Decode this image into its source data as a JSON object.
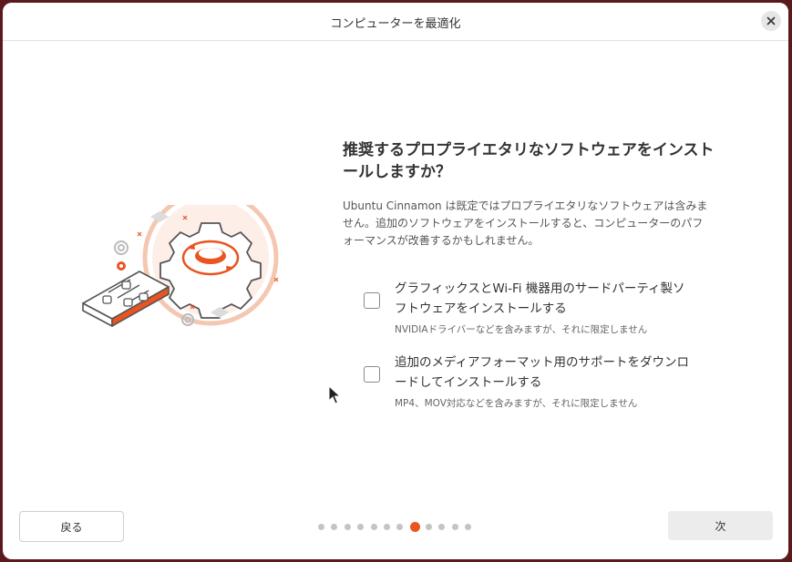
{
  "window": {
    "title": "コンピューターを最適化"
  },
  "content": {
    "heading": "推奨するプロプライエタリなソフトウェアをインストールしますか？",
    "description": "Ubuntu Cinnamon は既定ではプロプライエタリなソフトウェアは含みません。追加のソフトウェアをインストールすると、コンピューターのパフォーマンスが改善するかもしれません。",
    "options": [
      {
        "label": "グラフィックスとWi-Fi 機器用のサードパーティ製ソフトウェアをインストールする",
        "sublabel": "NVIDIAドライバーなどを含みますが、それに限定しません",
        "checked": false
      },
      {
        "label": "追加のメディアフォーマット用のサポートをダウンロードしてインストールする",
        "sublabel": "MP4、MOV対応などを含みますが、それに限定しません",
        "checked": false
      }
    ]
  },
  "footer": {
    "back_label": "戻る",
    "next_label": "次",
    "pagination": {
      "total": 12,
      "current": 8
    }
  },
  "colors": {
    "accent": "#e95420",
    "illustration_light": "#f4c7b3",
    "desktop": "#5a1a1c"
  },
  "icons": [
    "close-icon",
    "gear-icon",
    "mixer-sliders-icon",
    "mouse-pointer-icon"
  ]
}
